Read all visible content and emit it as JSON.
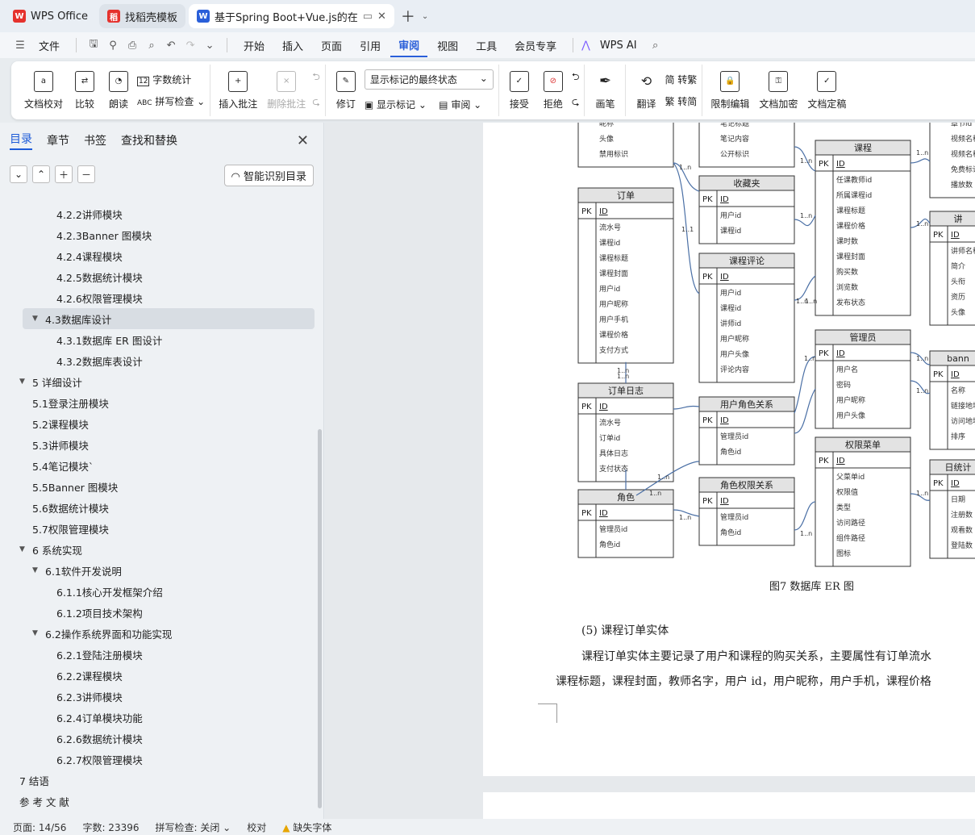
{
  "tabs": [
    {
      "label": "WPS Office",
      "icon": "wps-logo-icon",
      "color": "#e5322d"
    },
    {
      "label": "找稻壳模板",
      "icon": "docer-icon",
      "color": "#e5322d"
    },
    {
      "label": "基于Spring Boot+Vue.js的在",
      "icon": "writer-icon",
      "color": "#2a5fd9"
    }
  ],
  "menu": {
    "file": "文件",
    "items": [
      "开始",
      "插入",
      "页面",
      "引用",
      "审阅",
      "视图",
      "工具",
      "会员专享"
    ],
    "active": "审阅",
    "ai": "WPS AI"
  },
  "ribbon": {
    "doc_check": "文档校对",
    "compare": "比较",
    "read": "朗读",
    "word_count": "字数统计",
    "spell_check": "拼写检查",
    "insert_comment": "插入批注",
    "delete_comment": "删除批注",
    "revise": "修订",
    "markup_state": "显示标记的最终状态",
    "show_markup": "显示标记",
    "review": "审阅",
    "accept": "接受",
    "reject": "拒绝",
    "pen": "画笔",
    "translate": "翻译",
    "to_traditional": "简 转繁",
    "to_simplified": "繁 转简",
    "restrict": "限制编辑",
    "encrypt": "文档加密",
    "finalize": "文档定稿"
  },
  "panel": {
    "tabs": [
      "目录",
      "章节",
      "书签",
      "查找和替换"
    ],
    "smart_button": "智能识别目录",
    "toc": [
      {
        "text": "4.2.2讲师模块",
        "level": 3
      },
      {
        "text": "4.2.3Banner 图模块",
        "level": 3
      },
      {
        "text": "4.2.4课程模块",
        "level": 3
      },
      {
        "text": "4.2.5数据统计模块",
        "level": 3
      },
      {
        "text": "4.2.6权限管理模块",
        "level": 3
      },
      {
        "text": "4.3数据库设计",
        "level": 2,
        "expanded": true,
        "selected": true
      },
      {
        "text": "4.3.1数据库 ER 图设计",
        "level": 3
      },
      {
        "text": "4.3.2数据库表设计",
        "level": 3
      },
      {
        "text": "5   详细设计",
        "level": 1,
        "expanded": true
      },
      {
        "text": "5.1登录注册模块",
        "level": 2
      },
      {
        "text": "5.2课程模块",
        "level": 2
      },
      {
        "text": "5.3讲师模块",
        "level": 2
      },
      {
        "text": "5.4笔记模块`",
        "level": 2
      },
      {
        "text": "5.5Banner 图模块",
        "level": 2
      },
      {
        "text": "5.6数据统计模块",
        "level": 2
      },
      {
        "text": "5.7权限管理模块",
        "level": 2
      },
      {
        "text": "6   系统实现",
        "level": 1,
        "expanded": true
      },
      {
        "text": "6.1软件开发说明",
        "level": 2,
        "expanded": true
      },
      {
        "text": "6.1.1核心开发框架介绍",
        "level": 3
      },
      {
        "text": "6.1.2项目技术架构",
        "level": 3
      },
      {
        "text": "6.2操作系统界面和功能实现",
        "level": 2,
        "expanded": true
      },
      {
        "text": "6.2.1登陆注册模块",
        "level": 3
      },
      {
        "text": "6.2.2课程模块",
        "level": 3
      },
      {
        "text": "6.2.3讲师模块",
        "level": 3
      },
      {
        "text": "6.2.4订单模块功能",
        "level": 3
      },
      {
        "text": "6.2.6数据统计模块",
        "level": 3
      },
      {
        "text": "6.2.7权限管理模块",
        "level": 3
      },
      {
        "text": "7   结语",
        "level": 1
      },
      {
        "text": "参  考  文  献",
        "level": 1
      }
    ]
  },
  "document": {
    "caption": "图7 数据库 ER 图",
    "heading": "(5) 课程订单实体",
    "para1": "课程订单实体主要记录了用户和课程的购买关系，主要属性有订单流水",
    "para2": "课程标题，课程封面，教师名字，用户 id，用户昵称，用户手机，课程价格",
    "erd": {
      "pk": "PK",
      "tables": [
        {
          "title": "",
          "fields": [
            "昵称",
            "头像",
            "禁用标识"
          ]
        },
        {
          "title": "",
          "fields": [
            "笔记标题",
            "笔记内容",
            "公开标识"
          ]
        },
        {
          "title": "课程",
          "fields": [
            "ID",
            "任课教师id",
            "所属课程id",
            "课程标题",
            "课程价格",
            "课时数",
            "课程封面",
            "购买数",
            "浏览数",
            "发布状态"
          ]
        },
        {
          "title": "",
          "fields": [
            "章节id",
            "视频名称",
            "视频名称",
            "免费标识",
            "播放数"
          ]
        },
        {
          "title": "订单",
          "fields": [
            "ID",
            "流水号",
            "课程id",
            "课程标题",
            "课程封面",
            "用户id",
            "用户昵称",
            "用户手机",
            "课程价格",
            "支付方式"
          ]
        },
        {
          "title": "收藏夹",
          "fields": [
            "ID",
            "用户id",
            "课程id"
          ]
        },
        {
          "title": "课程评论",
          "fields": [
            "ID",
            "用户id",
            "课程id",
            "讲师id",
            "用户昵称",
            "用户头像",
            "评论内容"
          ]
        },
        {
          "title": "讲",
          "fields": [
            "ID",
            "讲师名称",
            "简介",
            "头衔",
            "资历",
            "头像"
          ]
        },
        {
          "title": "管理员",
          "fields": [
            "ID",
            "用户名",
            "密码",
            "用户昵称",
            "用户头像"
          ]
        },
        {
          "title": "bann",
          "fields": [
            "ID",
            "名称",
            "链接地址",
            "访问地址",
            "排序"
          ]
        },
        {
          "title": "订单日志",
          "fields": [
            "ID",
            "流水号",
            "订单id",
            "具体日志",
            "支付状态"
          ]
        },
        {
          "title": "用户角色关系",
          "fields": [
            "ID",
            "管理员id",
            "角色id"
          ]
        },
        {
          "title": "权限菜单",
          "fields": [
            "ID",
            "父菜单id",
            "权限值",
            "类型",
            "访问路径",
            "组件路径",
            "图标"
          ]
        },
        {
          "title": "日统计",
          "fields": [
            "ID",
            "日期",
            "注册数",
            "观看数",
            "登陆数"
          ]
        },
        {
          "title": "角色",
          "fields": [
            "ID",
            "管理员id",
            "角色id"
          ]
        },
        {
          "title": "角色权限关系",
          "fields": [
            "ID",
            "管理员id",
            "角色id"
          ]
        }
      ],
      "cardinality_labels": [
        "1..n",
        "1..1",
        "1..n",
        "1..n",
        "1..n",
        "1..n",
        "1..n",
        "1..n",
        "1..n",
        "1..n",
        "1..n",
        "1..n",
        "1..n",
        "1..n",
        "1..n",
        "1..n",
        "1..n",
        "1..n"
      ]
    }
  },
  "status": {
    "page": "页面: 14/56",
    "words": "字数: 23396",
    "spell": "拼写检查: 关闭",
    "proof": "校对",
    "missing_font": "缺失字体"
  }
}
